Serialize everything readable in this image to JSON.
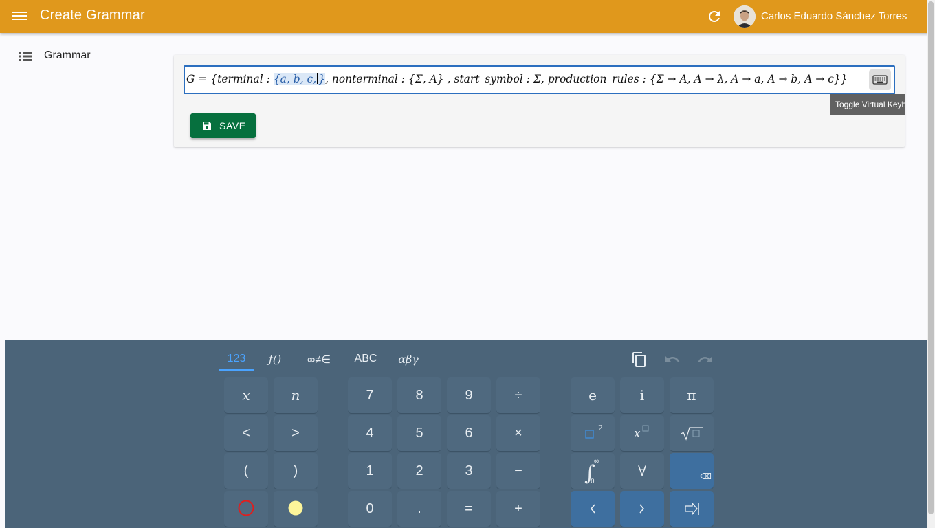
{
  "header": {
    "title": "Create Grammar",
    "user_name": "Carlos Eduardo Sánchez Torres",
    "bg_color": "#e0981c"
  },
  "sidebar": {
    "items": [
      {
        "label": "Grammar",
        "icon": "list-icon"
      }
    ]
  },
  "editor": {
    "formula_prefix": "G = {terminal : ",
    "formula_selected": "{a, b, c,",
    "formula_selected_close": "}",
    "formula_rest": ", nonterminal : {Σ, A} , start_symbol : Σ, production_rules : {Σ → A, A → λ, A → a, A → b, A → c}}",
    "tooltip": "Toggle Virtual Keyb",
    "save_label": "SAVE"
  },
  "keyboard": {
    "tabs": [
      "123",
      "ƒ()",
      "∞≠∈",
      "ABC",
      "αβγ"
    ],
    "active_tab": "123",
    "keys": {
      "r1": [
        "x",
        "n",
        "7",
        "8",
        "9",
        "÷",
        "e",
        "i",
        "π"
      ],
      "r2": [
        "<",
        ">",
        "4",
        "5",
        "6",
        "×",
        "□²",
        "x□",
        "√□"
      ],
      "r3": [
        "(",
        ")",
        "1",
        "2",
        "3",
        "−",
        "∫₀^∞",
        "∀",
        "⌫"
      ],
      "r4": [
        "○",
        "●",
        "0",
        ".",
        "=",
        "+",
        "<",
        ">",
        "⇥"
      ]
    }
  }
}
